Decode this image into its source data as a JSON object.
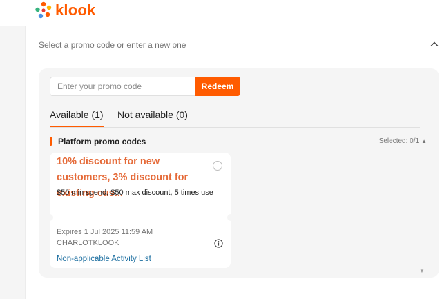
{
  "header": {
    "logo_text": "klook"
  },
  "promo_section": {
    "label": "Select a promo code or enter a new one",
    "chevron_icon": "chevron-up-icon"
  },
  "panel": {
    "input_placeholder": "Enter your promo code",
    "input_value": "",
    "redeem_label": "Redeem",
    "tabs": [
      {
        "label": "Available (1)",
        "active": true
      },
      {
        "label": "Not available (0)",
        "active": false
      }
    ],
    "category": {
      "label": "Platform promo codes",
      "selected_label": "Selected: 0/1",
      "caret_icon": "caret-up-icon"
    },
    "coupons": [
      {
        "title": "10% discount for new customers, 3% discount for existing cus...",
        "description": "$50 min spend, $50 max discount, 5 times use",
        "expiry": "Expires 1 Jul 2025 11:59 AM",
        "code": "CHARLOTKLOOK",
        "link_label": "Non-applicable Activity List",
        "selected": false
      }
    ]
  },
  "colors": {
    "brand": "#ff5b00",
    "coupon_title": "#e56a38",
    "link": "#1a6d9f",
    "panel_bg": "#f5f5f5"
  }
}
